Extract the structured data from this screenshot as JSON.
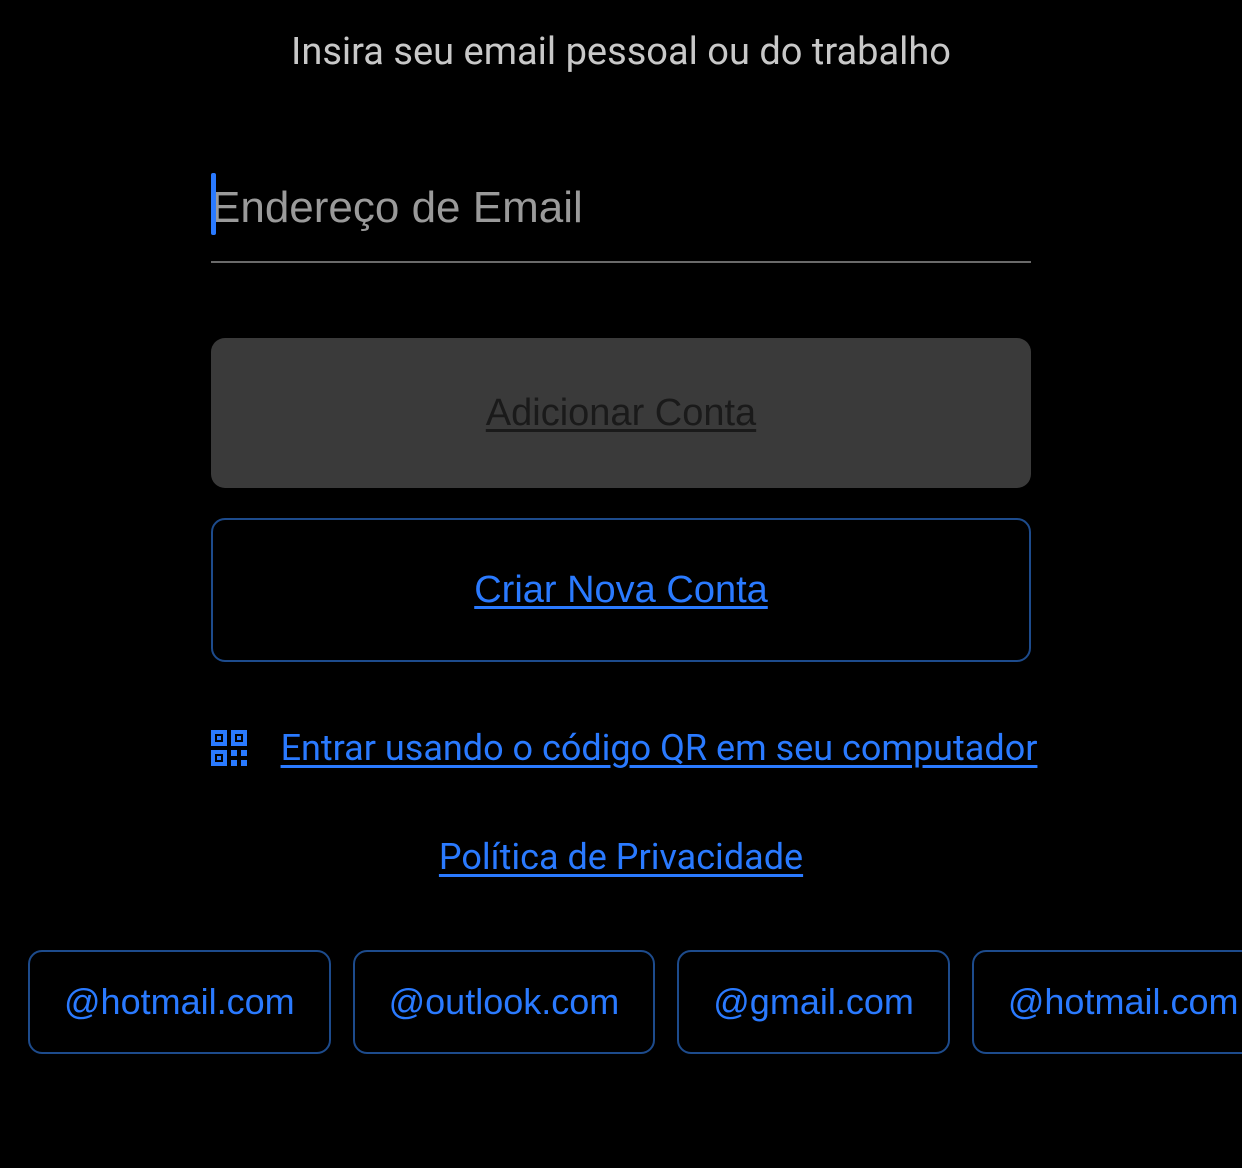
{
  "header": {
    "instruction": "Insira seu email pessoal ou do trabalho"
  },
  "form": {
    "email_placeholder": "Endereço de Email",
    "email_value": ""
  },
  "buttons": {
    "add_account": "Adicionar Conta",
    "create_account": "Criar Nova Conta"
  },
  "links": {
    "qr_login": "Entrar usando o código QR em seu computador",
    "privacy_policy": "Política de Privacidade"
  },
  "suggestions": [
    "@hotmail.com",
    "@outlook.com",
    "@gmail.com",
    "@hotmail.com"
  ],
  "colors": {
    "background": "#000000",
    "accent": "#2a7aff",
    "text_secondary": "#c8c8c8",
    "button_disabled_bg": "#3a3a3a"
  }
}
